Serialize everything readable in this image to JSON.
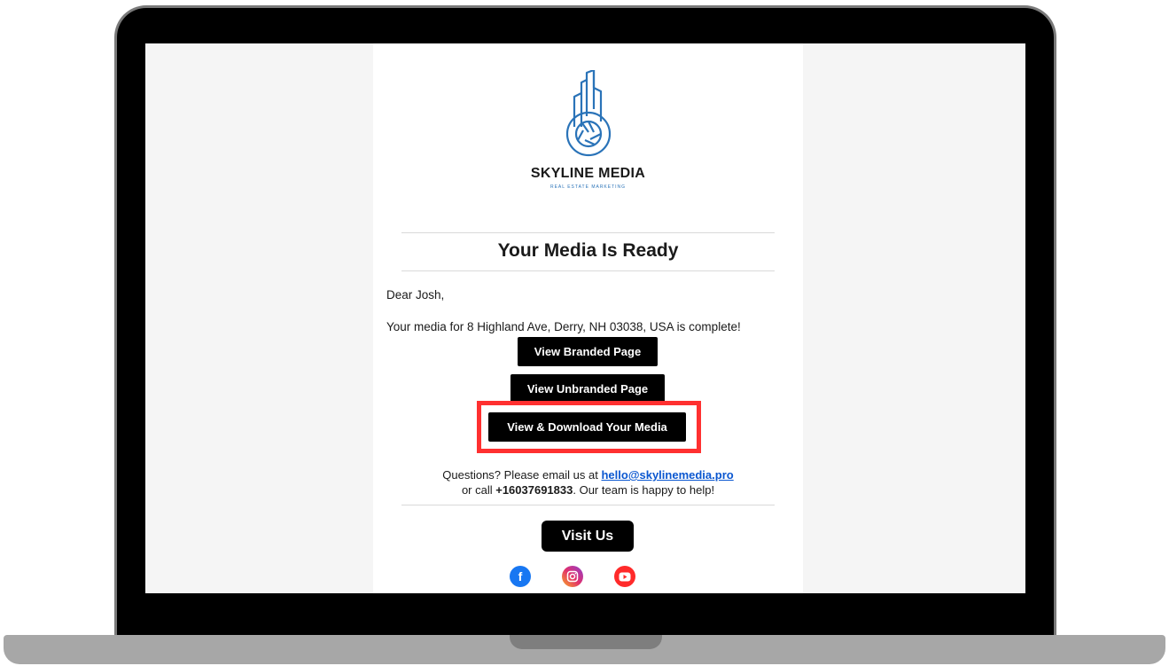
{
  "email": {
    "brand": {
      "name": "SKYLINE MEDIA",
      "tagline": "REAL ESTATE MARKETING",
      "logo_icon": "building-camera-aperture-logo",
      "logo_color": "#2a73b8"
    },
    "heading": "Your Media Is Ready",
    "greeting": "Dear Josh,",
    "message": "Your media for 8 Highland Ave, Derry, NH 03038, USA is complete!",
    "buttons": {
      "branded": "View Branded Page",
      "unbranded": "View Unbranded Page",
      "download": "View & Download Your Media"
    },
    "contact": {
      "line1_prefix": "Questions? Please email us at ",
      "email": "hello@skylinemedia.pro",
      "line2_prefix": "or call ",
      "phone": "+16037691833",
      "line2_suffix": ". Our team is happy to help!"
    },
    "visit_button": "Visit Us",
    "social": [
      {
        "icon": "facebook-icon",
        "color": "#1877f2"
      },
      {
        "icon": "instagram-icon",
        "color": "#e1306c"
      },
      {
        "icon": "youtube-icon",
        "color": "#ff2a2a"
      }
    ],
    "highlight_color": "#ff3030"
  }
}
